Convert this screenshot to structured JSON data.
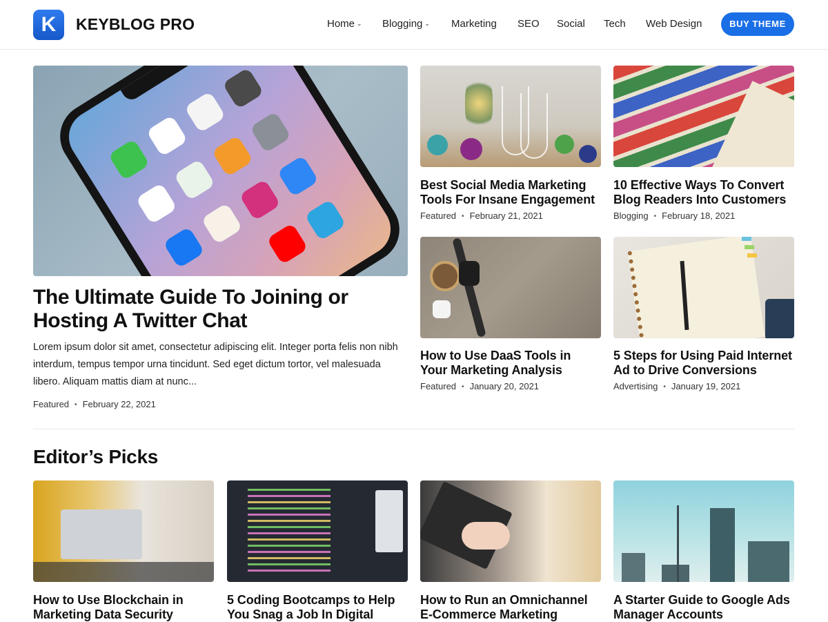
{
  "brand": {
    "logo_letter": "K",
    "name": "KEYBLOG PRO"
  },
  "nav": {
    "items": [
      {
        "label": "Home",
        "dropdown": true
      },
      {
        "label": "Blogging",
        "dropdown": true
      },
      {
        "label": "Marketing",
        "dropdown": false
      },
      {
        "label": "SEO",
        "dropdown": false
      },
      {
        "label": "Social",
        "dropdown": false
      },
      {
        "label": "Tech",
        "dropdown": false
      },
      {
        "label": "Web Design",
        "dropdown": false
      }
    ],
    "chevron": "⌄",
    "cta_label": "BUY THEME"
  },
  "hero": {
    "image_icon": "smartphone-image",
    "title": "The Ultimate Guide To Joining or Hosting A Twitter Chat",
    "excerpt": "Lorem ipsum dolor sit amet, consectetur adipiscing elit. Integer porta felis non nibh interdum, tempus tempor urna tincidunt. Sed eget dictum tortor, vel malesuada libero. Aliquam mattis diam at nunc...",
    "category": "Featured",
    "date": "February 22, 2021"
  },
  "featured_cards": [
    {
      "title": "Best Social Media Marketing Tools For Insane Engagement",
      "category": "Featured",
      "date": "February 21, 2021",
      "image_icon": "wine-glasses-image"
    },
    {
      "title": "10 Effective Ways To Convert Blog Readers Into Customers",
      "category": "Blogging",
      "date": "February 18, 2021",
      "image_icon": "crayons-image"
    },
    {
      "title": "How to Use DaaS Tools in Your Marketing Analysis",
      "category": "Featured",
      "date": "January 20, 2021",
      "image_icon": "desk-watch-image"
    },
    {
      "title": "5 Steps for Using Paid Internet Ad to Drive Conversions",
      "category": "Advertising",
      "date": "January 19, 2021",
      "image_icon": "notebook-pen-image"
    }
  ],
  "editors_picks": {
    "heading": "Editor’s Picks",
    "cards": [
      {
        "title": "How to Use Blockchain in Marketing Data Security",
        "image_icon": "laptop-people-image"
      },
      {
        "title": "5 Coding Bootcamps to Help You Snag a Job In Digital",
        "image_icon": "code-screen-image"
      },
      {
        "title": "How to Run an Omnichannel E-Commerce Marketing",
        "image_icon": "typing-laptop-image"
      },
      {
        "title": "A Starter Guide to Google Ads Manager Accounts",
        "image_icon": "city-skyline-image"
      }
    ]
  },
  "meta_separator": "•",
  "colors": {
    "accent": "#1a6ee6",
    "text": "#111111",
    "divider": "#e8e8e8"
  }
}
